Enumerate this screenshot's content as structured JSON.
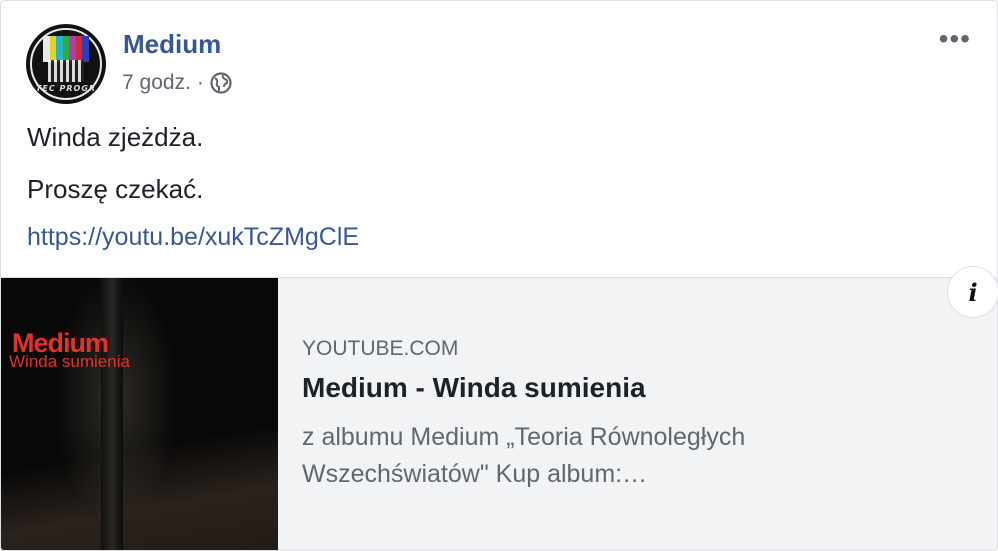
{
  "post": {
    "page_name": "Medium",
    "time": "7 godz.",
    "separator": "·",
    "lines": [
      "Winda zjeżdża.",
      "Proszę czekać."
    ],
    "link": "https://youtu.be/xukTcZMgClE",
    "more_icon": "more-horizontal-icon",
    "audience_icon": "globe-icon",
    "avatar_text": "TEC PROGR"
  },
  "preview": {
    "domain": "YOUTUBE.COM",
    "title": "Medium - Winda sumienia",
    "description": "z albumu Medium „Teoria Równoległych Wszechświatów\" Kup album:…",
    "thumb_title": "Medium",
    "thumb_subtitle": "Winda sumienia",
    "info_icon": "info-icon"
  },
  "colors": {
    "page_name": "#365899",
    "link": "#385898",
    "thumb_title": "#e3322a",
    "preview_bg": "#f2f3f5"
  }
}
